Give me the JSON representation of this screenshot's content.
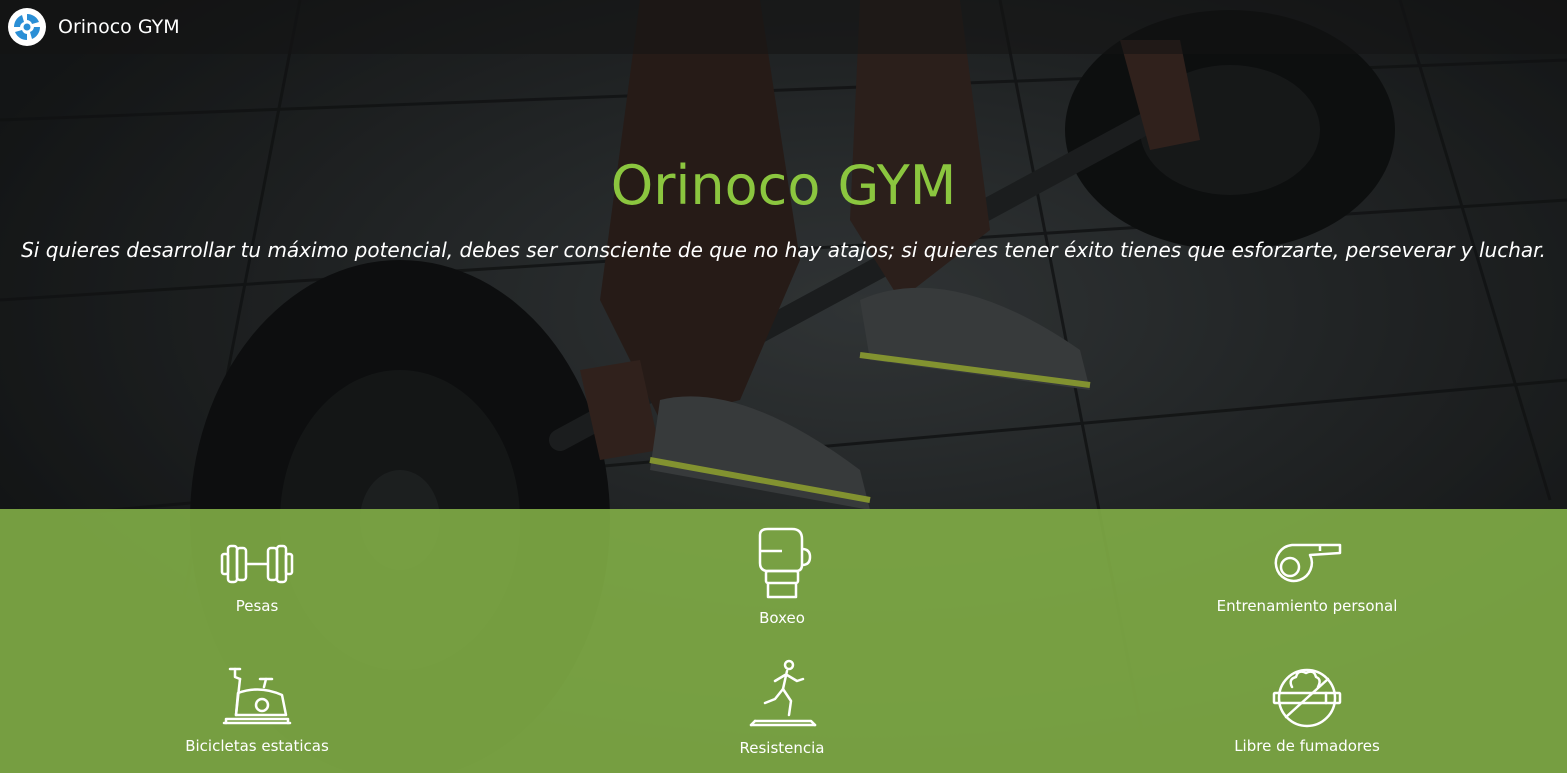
{
  "navbar": {
    "brand": "Orinoco GYM",
    "logo_icon": "spiral-logo-icon"
  },
  "hero": {
    "title": "Orinoco GYM",
    "quote": "Si quieres desarrollar tu máximo potencial, debes ser consciente de que no hay atajos; si quieres tener éxito tienes que esforzarte, perseverar y luchar.",
    "background": "barbell-deadlift-photo"
  },
  "colors": {
    "accent": "#8bc63f",
    "services_band": "#84b248"
  },
  "services": [
    {
      "label": "Pesas",
      "icon": "dumbbell-icon"
    },
    {
      "label": "Boxeo",
      "icon": "boxing-glove-icon"
    },
    {
      "label": "Entrenamiento personal",
      "icon": "whistle-icon"
    },
    {
      "label": "Bicicletas estaticas",
      "icon": "stationary-bike-icon"
    },
    {
      "label": "Resistencia",
      "icon": "treadmill-runner-icon"
    },
    {
      "label": "Libre de fumadores",
      "icon": "no-smoking-icon"
    }
  ]
}
